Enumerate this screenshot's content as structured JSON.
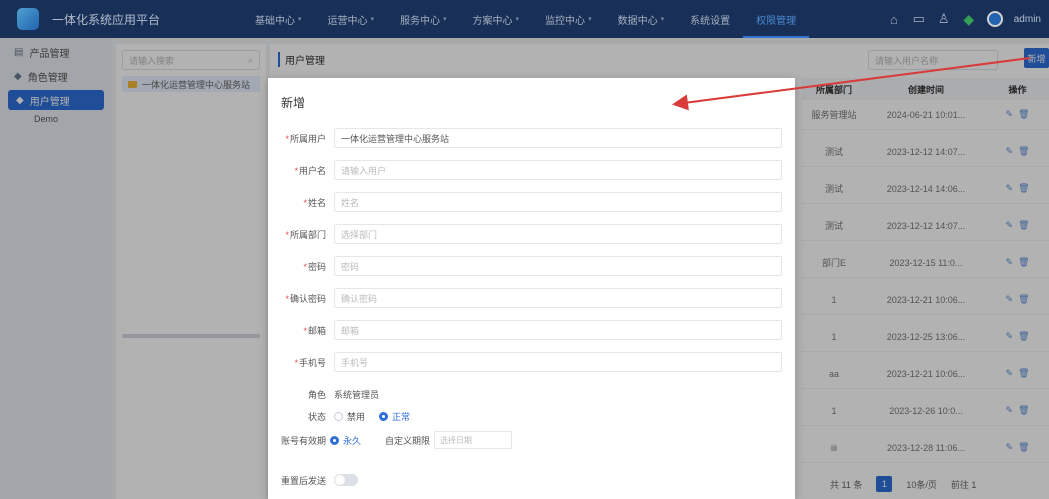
{
  "header": {
    "app_title": "一体化系统应用平台",
    "nav": [
      {
        "label": "基础中心",
        "caret": "▾"
      },
      {
        "label": "运营中心",
        "caret": "▾"
      },
      {
        "label": "服务中心",
        "caret": "▾"
      },
      {
        "label": "方案中心",
        "caret": "▾"
      },
      {
        "label": "监控中心",
        "caret": "▾"
      },
      {
        "label": "数据中心",
        "caret": "▾"
      },
      {
        "label": "系统设置",
        "caret": ""
      },
      {
        "label": "权限管理",
        "caret": ""
      }
    ],
    "icons": [
      "home-icon",
      "message-icon",
      "user-icon",
      "notify-icon"
    ],
    "username": "admin"
  },
  "sidebar": {
    "items": [
      {
        "label": "产品管理",
        "icon": "▤"
      },
      {
        "label": "角色管理",
        "icon": "◆"
      },
      {
        "label": "用户管理",
        "icon": "◆"
      }
    ],
    "sub": "Demo"
  },
  "tree": {
    "search_placeholder": "请输入搜索",
    "node": "一体化运营管理中心服务站"
  },
  "main": {
    "title": "用户管理",
    "search_placeholder": "请输入用户名称",
    "add_label": "新增",
    "columns": {
      "dept": "所属部门",
      "time": "创建时间",
      "op": "操作"
    },
    "rows": [
      {
        "dept": "服务管理站",
        "time": "2024-06-21 10:01..."
      },
      {
        "dept": "测试",
        "time": "2023-12-12 14:07..."
      },
      {
        "dept": "测试",
        "time": "2023-12-14 14:06..."
      },
      {
        "dept": "测试",
        "time": "2023-12-12 14:07..."
      },
      {
        "dept": "部门E",
        "time": "2023-12-15 11:0..."
      },
      {
        "dept": "1",
        "time": "2023-12-21 10:06..."
      },
      {
        "dept": "1",
        "time": "2023-12-25 13:06..."
      },
      {
        "dept": "aa",
        "time": "2023-12-21 10:06..."
      },
      {
        "dept": "1",
        "time": "2023-12-26 10:0..."
      },
      {
        "dept": "iii",
        "time": "2023-12-28 11:06..."
      }
    ],
    "pager": {
      "total": "共 11 条",
      "current": "1",
      "page_size": "10条/页",
      "jump": "前往 1"
    }
  },
  "modal": {
    "title": "新增",
    "fields": [
      {
        "label": "所属用户",
        "required": true,
        "value": "一体化运营管理中心服务站",
        "filled": true
      },
      {
        "label": "用户名",
        "required": true,
        "value": "请输入用户",
        "filled": false
      },
      {
        "label": "姓名",
        "required": true,
        "value": "姓名",
        "filled": false
      },
      {
        "label": "所属部门",
        "required": true,
        "value": "选择部门",
        "filled": false
      },
      {
        "label": "密码",
        "required": true,
        "value": "密码",
        "filled": false
      },
      {
        "label": "确认密码",
        "required": true,
        "value": "确认密码",
        "filled": false
      },
      {
        "label": "邮箱",
        "required": true,
        "value": "邮箱",
        "filled": false
      },
      {
        "label": "手机号",
        "required": true,
        "value": "手机号",
        "filled": false
      }
    ],
    "role": {
      "label": "角色",
      "value": "系统管理员"
    },
    "status": {
      "label": "状态",
      "off": "禁用",
      "on": "正常"
    },
    "expire": {
      "label": "账号有效期",
      "option": "永久",
      "custom_label": "自定义期限",
      "custom_placeholder": "选择日期"
    },
    "notify": {
      "label": "重置后发送"
    }
  }
}
